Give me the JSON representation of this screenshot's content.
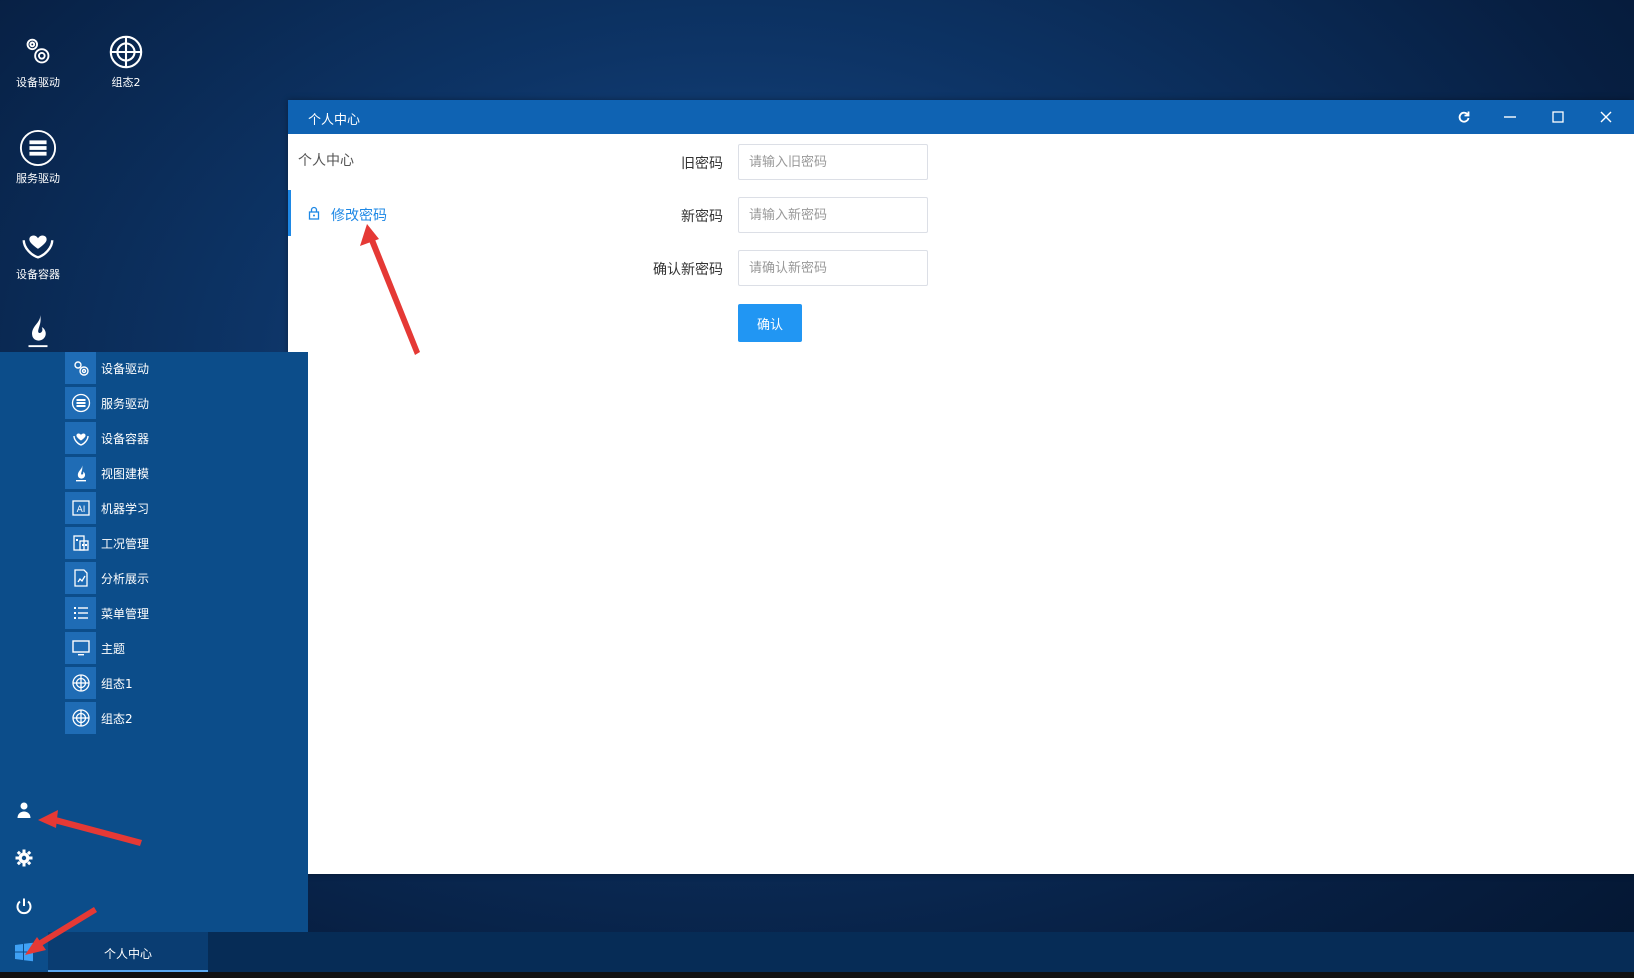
{
  "desktop": {
    "icons": [
      {
        "label": "设备驱动",
        "icon": "gears-icon"
      },
      {
        "label": "组态2",
        "icon": "globe-target-icon"
      },
      {
        "label": "服务驱动",
        "icon": "server-icon"
      },
      {
        "label": "设备容器",
        "icon": "hands-heart-icon"
      },
      {
        "label": "视图建模",
        "icon": "flame-icon"
      }
    ]
  },
  "window": {
    "title": "个人中心",
    "controls": [
      "refresh-icon",
      "minimize-icon",
      "maximize-icon",
      "close-icon"
    ],
    "sidebar": {
      "heading": "个人中心",
      "active_item": "修改密码"
    },
    "form": {
      "old_label": "旧密码",
      "old_placeholder": "请输入旧密码",
      "new_label": "新密码",
      "new_placeholder": "请输入新密码",
      "confirm_label": "确认新密码",
      "confirm_placeholder": "请确认新密码",
      "submit": "确认"
    }
  },
  "start_menu": {
    "items": [
      {
        "label": "设备驱动",
        "icon": "gears-icon"
      },
      {
        "label": "服务驱动",
        "icon": "server-icon"
      },
      {
        "label": "设备容器",
        "icon": "hands-heart-icon"
      },
      {
        "label": "视图建模",
        "icon": "flame-icon"
      },
      {
        "label": "机器学习",
        "icon": "ai-icon"
      },
      {
        "label": "工况管理",
        "icon": "building-icon"
      },
      {
        "label": "分析展示",
        "icon": "chart-file-icon"
      },
      {
        "label": "菜单管理",
        "icon": "list-icon"
      },
      {
        "label": "主题",
        "icon": "monitor-icon"
      },
      {
        "label": "组态1",
        "icon": "globe-target-icon"
      },
      {
        "label": "组态2",
        "icon": "globe-target-icon"
      }
    ],
    "side_icons": [
      "user-icon",
      "settings-icon",
      "power-icon"
    ]
  },
  "taskbar": {
    "start_icon": "windows-logo-icon",
    "active_task": "个人中心"
  },
  "colors": {
    "titlebar": "#0f63b3",
    "accent": "#1e88e5",
    "button": "#2196f3",
    "start_menu": "#0c4d8a",
    "annotation_arrow": "#e53935"
  }
}
